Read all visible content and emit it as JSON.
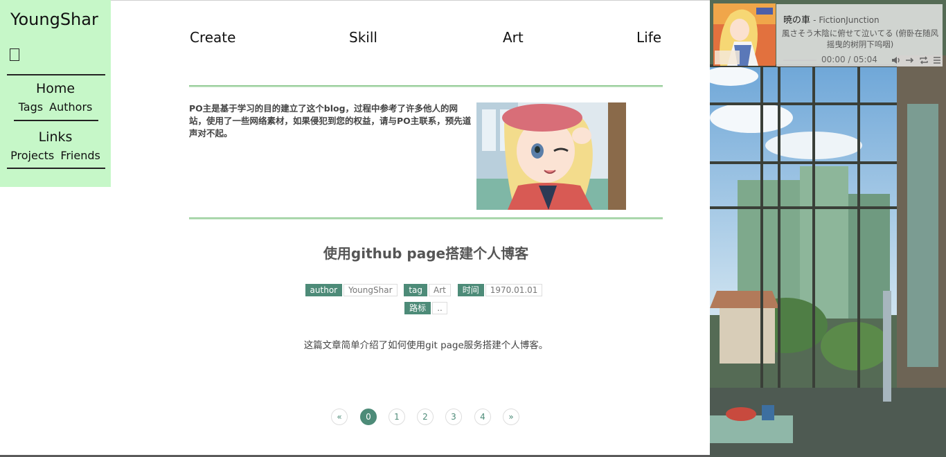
{
  "sidebar": {
    "brand": "YoungShar",
    "home_label": "Home",
    "home_subitems": [
      "Tags",
      "Authors"
    ],
    "links_label": "Links",
    "links_subitems": [
      "Projects",
      "Friends"
    ]
  },
  "nav": {
    "items": [
      "Create",
      "Skill",
      "Art",
      "Life"
    ]
  },
  "intro": {
    "text": "PO主是基于学习的目的建立了这个blog，过程中参考了许多他人的网站，使用了一些网络素材，如果侵犯到您的权益，请与PO主联系，预先道声对不起。"
  },
  "article": {
    "title": "使用github page搭建个人博客",
    "meta": {
      "author_label": "author",
      "author_value": "YoungShar",
      "tag_label": "tag",
      "tag_value": "Art",
      "time_label": "时间",
      "time_value": "1970.01.01",
      "path_label": "路标",
      "path_value": ".."
    },
    "summary": "这篇文章简单介绍了如何使用git page服务搭建个人博客。"
  },
  "pagination": {
    "prev": "«",
    "pages": [
      "0",
      "1",
      "2",
      "3",
      "4"
    ],
    "next": "»",
    "current": "0"
  },
  "player": {
    "song": "暁の車",
    "artist": "FictionJunction",
    "lyric": "風さそう木陰に俯せて泣いてる (俯卧在随风摇曳的树阴下呜咽)",
    "time": "00:00 / 05:04",
    "progress": 0
  },
  "colors": {
    "sidebar_bg": "#c6f7c8",
    "accent": "#4d8b78",
    "divider": "#9fd3a1"
  }
}
